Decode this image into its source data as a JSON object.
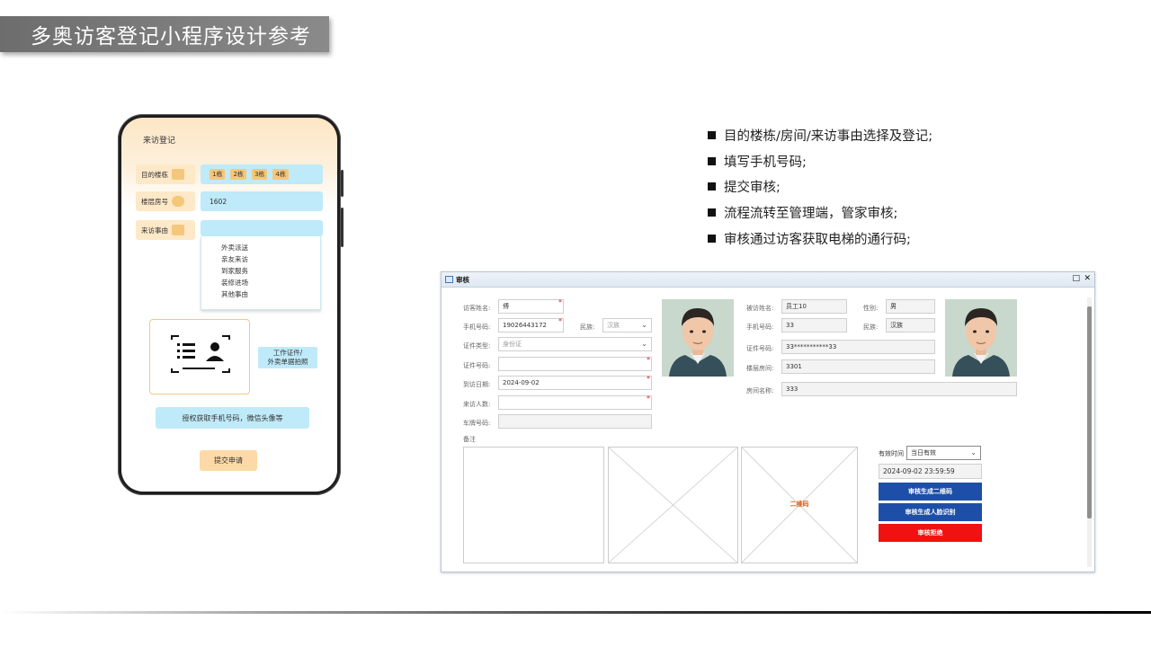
{
  "slide": {
    "title": "多奥访客登记小程序设计参考"
  },
  "phone": {
    "screen_title": "来访登记",
    "building_label": "目的楼栋",
    "building_chips": [
      "1栋",
      "2栋",
      "3栋",
      "4栋"
    ],
    "room_label": "楼层房号",
    "room_value": "1602",
    "reason_label": "来访事由",
    "reason_options": [
      "外卖派送",
      "亲友来访",
      "到家服务",
      "装修进场",
      "其他事由"
    ],
    "upload_label_1": "工作证件/",
    "upload_label_2": "外卖单据拍照",
    "auth_button": "授权获取手机号码，微信头像等",
    "submit_button": "提交申请"
  },
  "bullets": [
    "目的楼栋/房间/来访事由选择及登记;",
    "填写手机号码;",
    "提交审核;",
    "流程流转至管理端，管家审核;",
    "审核通过访客获取电梯的通行码;"
  ],
  "review_window": {
    "title": "审核",
    "maximize_icon": "□",
    "close_icon": "✕",
    "visitor_name_label": "访客姓名:",
    "visitor_name_value": "傅",
    "phone_label": "手机号码:",
    "phone_value": "19026443172",
    "ethnicity_label": "民族:",
    "ethnicity_value": "汉族",
    "id_type_label": "证件类型:",
    "id_type_value": "身份证",
    "id_no_label": "证件号码:",
    "id_no_value": "",
    "visit_date_label": "到访日期:",
    "visit_date_value": "2024-09-02",
    "visitors_count_label": "来访人数:",
    "visitors_count_value": "",
    "plate_label": "车牌号码:",
    "plate_value": "",
    "remark_label": "备注",
    "host_name_label": "被访姓名:",
    "host_name_value": "员工10",
    "gender_label": "性别:",
    "gender_value": "男",
    "host_phone_label": "手机号码:",
    "host_phone_value": "33",
    "host_ethnicity_label": "民族:",
    "host_ethnicity_value": "汉族",
    "host_id_label": "证件号码:",
    "host_id_value": "33***********33",
    "floor_room_label": "楼层房间:",
    "floor_room_value": "3301",
    "room_name_label": "房间名称:",
    "room_name_value": "333",
    "qr_placeholder": "二维码",
    "valid_time_label": "有效时间",
    "valid_time_value": "当日有效",
    "valid_until": "2024-09-02 23:59:59",
    "btn_gen_qr": "审核生成二维码",
    "btn_gen_face": "审核生成人脸识别",
    "btn_reject": "审核拒绝"
  }
}
